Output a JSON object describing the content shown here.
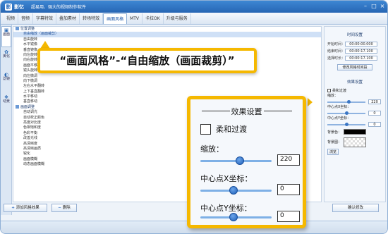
{
  "app": {
    "name": "影忆",
    "tagline": "超易用、强大的视频制作软件",
    "logo_text": "影",
    "controls": [
      "–",
      "□",
      "×"
    ]
  },
  "tabs": [
    {
      "label": "视频"
    },
    {
      "label": "音频"
    },
    {
      "label": "字幕特效"
    },
    {
      "label": "叠加素材"
    },
    {
      "label": "转场特效"
    },
    {
      "label": "画面风格",
      "active": true
    },
    {
      "label": "MTV"
    },
    {
      "label": "卡拉OK"
    },
    {
      "label": "升级与服务"
    }
  ],
  "sidebar": [
    {
      "label": "画面",
      "icon": "▣",
      "active": true
    },
    {
      "label": "美化",
      "icon": "✿"
    },
    {
      "label": "滤镜",
      "icon": "◐"
    },
    {
      "label": "动景",
      "icon": "❖"
    }
  ],
  "list": {
    "items": [
      {
        "label": "位置调整",
        "type": "group"
      },
      {
        "label": "自由缩放（画面裁剪）",
        "type": "item",
        "selected": true
      },
      {
        "label": "自由旋转",
        "type": "item"
      },
      {
        "label": "水平镜像",
        "type": "item"
      },
      {
        "label": "垂直镜像",
        "type": "item"
      },
      {
        "label": "向左旋转",
        "type": "item"
      },
      {
        "label": "向右旋转",
        "type": "item"
      },
      {
        "label": "画面平移",
        "type": "item"
      },
      {
        "label": "镜头旋转",
        "type": "item"
      },
      {
        "label": "向左微调",
        "type": "item"
      },
      {
        "label": "向下微调",
        "type": "item"
      },
      {
        "label": "左右水平翻转",
        "type": "item"
      },
      {
        "label": "上下垂直翻转",
        "type": "item"
      },
      {
        "label": "水平移动",
        "type": "item"
      },
      {
        "label": "垂直移动",
        "type": "item"
      },
      {
        "label": "画面调整",
        "type": "group"
      },
      {
        "label": "自动调光",
        "type": "item"
      },
      {
        "label": "自动校正颜色",
        "type": "item"
      },
      {
        "label": "亮度对比度",
        "type": "item"
      },
      {
        "label": "色相饱和度",
        "type": "item"
      },
      {
        "label": "色彩平衡",
        "type": "item"
      },
      {
        "label": "改善光线",
        "type": "item"
      },
      {
        "label": "高清晰度",
        "type": "item"
      },
      {
        "label": "高清晰画质",
        "type": "item"
      },
      {
        "label": "锐化",
        "type": "item"
      },
      {
        "label": "画面模糊",
        "type": "item"
      },
      {
        "label": "动态画面模糊",
        "type": "item"
      }
    ]
  },
  "right_panel": {
    "time_title": "时间设置",
    "start_label": "开始时间：",
    "start_value": "00:00:00.000",
    "end_label": "结束时间：",
    "end_value": "00:00:17.100",
    "duration_label": "选择时长：",
    "duration_value": "00:00:17.100",
    "modify_button": "修改风格时间段",
    "effect_title": "效果设置",
    "soft_label": "柔和过渡",
    "zoom_label": "缩放：",
    "zoom_value": "220",
    "cx_label": "中心点X坐标：",
    "cx_value": "0",
    "cy_label": "中心点Y坐标：",
    "cy_value": "0",
    "bg_color_label": "背景色：",
    "bg_image_label": "背景图：",
    "browse_button": "浏览"
  },
  "bottom": {
    "add_button": "添加风格效果",
    "delete_button": "删除",
    "confirm_button": "确认修改",
    "plus_icon": "+",
    "minus_icon": "−"
  },
  "callout": {
    "text": "“画面风格”-“自由缩放（画面裁剪）”"
  },
  "zoom_panel": {
    "title": "效果设置",
    "soft_label": "柔和过渡",
    "soft_checked": false,
    "zoom_label": "缩放：",
    "zoom_value": "220",
    "zoom_level": 0.55,
    "cx_label": "中心点X坐标：",
    "cx_value": "0",
    "cx_level": 0.47,
    "cy_label": "中心点Y坐标：",
    "cy_value": "0",
    "cy_level": 0.47
  },
  "colors": {
    "accent": "#f5b800",
    "title_blue": "#2766b4"
  }
}
